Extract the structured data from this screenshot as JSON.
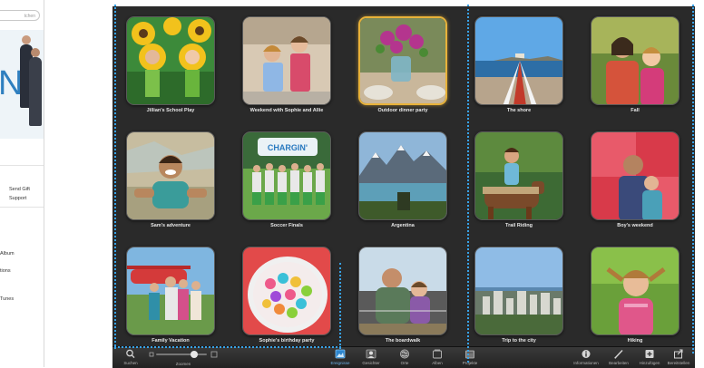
{
  "left_panel": {
    "search_placeholder": "tchen",
    "hero_letter": "N",
    "links": [
      "Send Gift",
      "Support"
    ],
    "items": [
      "Album",
      "tions",
      "Tunes"
    ]
  },
  "photos": [
    {
      "caption": "Jillian's School Play",
      "scene": "sunflowers"
    },
    {
      "caption": "Weekend with Sophie and Allie",
      "scene": "kids"
    },
    {
      "caption": "Outdoor dinner party",
      "scene": "flowers",
      "selected": true
    },
    {
      "caption": "The shore",
      "scene": "pier"
    },
    {
      "caption": "Fall",
      "scene": "mother"
    },
    {
      "caption": "Sam's adventure",
      "scene": "boy"
    },
    {
      "caption": "Soccer Finals",
      "scene": "team"
    },
    {
      "caption": "Argentina",
      "scene": "mountains"
    },
    {
      "caption": "Trail Riding",
      "scene": "horse"
    },
    {
      "caption": "Boy's weekend",
      "scene": "father"
    },
    {
      "caption": "Family Vacation",
      "scene": "plane"
    },
    {
      "caption": "Sophie's birthday party",
      "scene": "candy"
    },
    {
      "caption": "The boardwalk",
      "scene": "boardwalk"
    },
    {
      "caption": "Trip to the city",
      "scene": "city"
    },
    {
      "caption": "Hiking",
      "scene": "girl"
    }
  ],
  "toolbar": {
    "left": [
      {
        "label": "Suchen",
        "icon": "search-icon"
      },
      {
        "label": "Zoomen",
        "icon": "zoom-slider"
      }
    ],
    "zoom_level": 0.75,
    "center": [
      {
        "label": "Ereignisse",
        "icon": "events-icon",
        "active": true
      },
      {
        "label": "Gesichter",
        "icon": "faces-icon"
      },
      {
        "label": "Orte",
        "icon": "places-icon"
      },
      {
        "label": "Alben",
        "icon": "albums-icon"
      },
      {
        "label": "Projekte",
        "icon": "projects-icon"
      }
    ],
    "right": [
      {
        "label": "Informationen",
        "icon": "info-icon"
      },
      {
        "label": "Bearbeiten",
        "icon": "edit-icon"
      },
      {
        "label": "Hinzufügen",
        "icon": "add-icon"
      },
      {
        "label": "Bereitstellen",
        "icon": "share-icon"
      }
    ]
  },
  "colors": {
    "accent": "#37a2e8",
    "selection": "#e8b23a",
    "background": "#2a2a2a"
  }
}
